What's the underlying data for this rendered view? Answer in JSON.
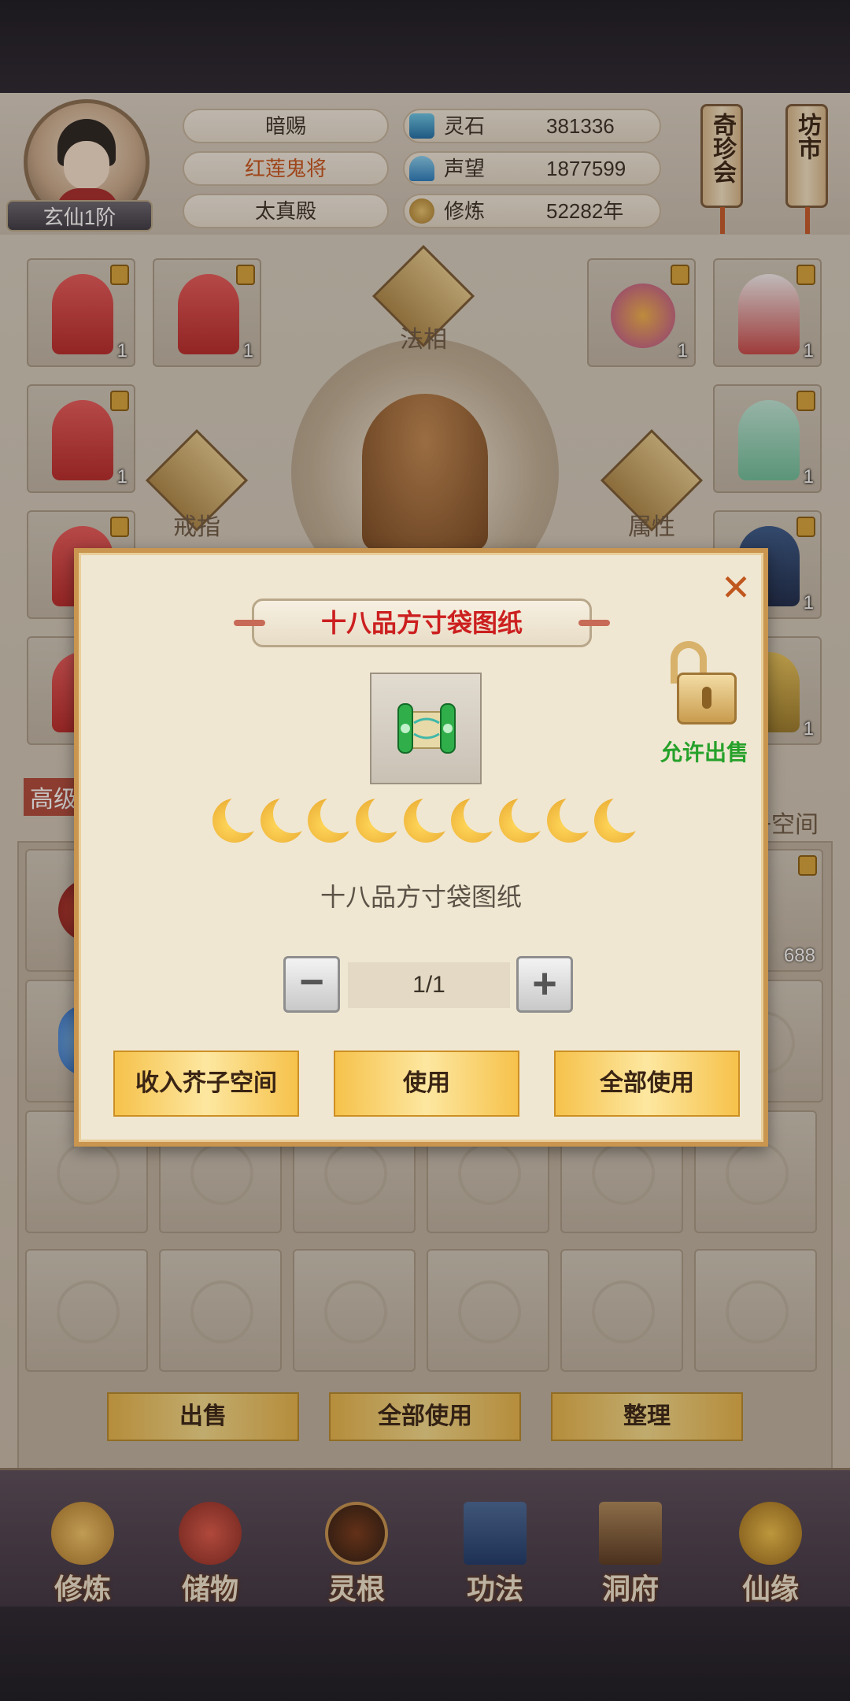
{
  "header": {
    "rank": "玄仙1阶",
    "pills": [
      "暗赐",
      "红莲鬼将",
      "太真殿"
    ],
    "pill_colors": [
      "#3a2f26",
      "#c9541c",
      "#3a2f26"
    ],
    "stats": [
      {
        "label": "灵石",
        "value": "381336",
        "icon": "spirit-stone-icon"
      },
      {
        "label": "声望",
        "value": "1877599",
        "icon": "reputation-icon"
      },
      {
        "label": "修炼",
        "value": "52282年",
        "icon": "cultivation-icon"
      }
    ],
    "side_buttons": [
      "奇珍会",
      "坊市"
    ]
  },
  "equip": {
    "center_labels": {
      "top": "法相",
      "left": "戒指",
      "right": "属性"
    },
    "partial_labels": {
      "left": "高级",
      "right": "子空间"
    },
    "counts": [
      "1",
      "1",
      "1",
      "1",
      "1",
      "1",
      "1",
      "1",
      "1"
    ],
    "partial_count": "688"
  },
  "actions": {
    "sell": "出售",
    "use_all": "全部使用",
    "sort": "整理"
  },
  "nav": [
    {
      "label": "修炼",
      "icon": "cultivation-nav-icon"
    },
    {
      "label": "储物",
      "icon": "storage-bag-icon"
    },
    {
      "label": "灵根",
      "icon": "spirit-root-icon"
    },
    {
      "label": "功法",
      "icon": "technique-book-icon"
    },
    {
      "label": "洞府",
      "icon": "cave-mansion-icon"
    },
    {
      "label": "仙缘",
      "icon": "immortal-fate-icon"
    }
  ],
  "dialog": {
    "title": "十八品方寸袋图纸",
    "item_name": "十八品方寸袋图纸",
    "moon_count": 9,
    "allow_sell": "允许出售",
    "quantity": "1/1",
    "minus": "−",
    "plus": "+",
    "close": "✕",
    "buttons": {
      "store": "收入芥子空间",
      "use": "使用",
      "use_all": "全部使用"
    },
    "colors": {
      "title": "#cc1f1f",
      "allow_sell": "#26a12a"
    }
  }
}
